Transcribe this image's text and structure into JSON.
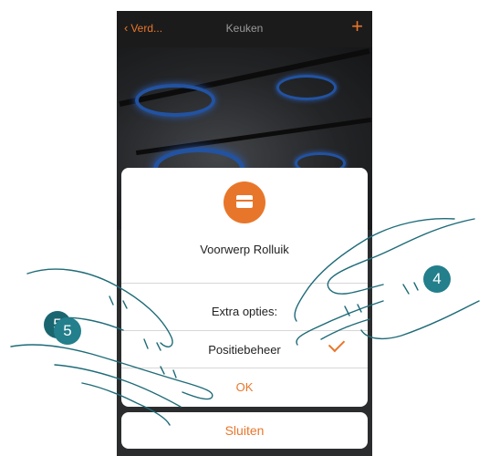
{
  "header": {
    "back_label": "Verd...",
    "title": "Keuken",
    "add_symbol": "+"
  },
  "dialog": {
    "object_label": "Voorwerp Rolluik",
    "extra_label": "Extra opties:",
    "option_label": "Positiebeheer",
    "option_selected": true,
    "ok_label": "OK"
  },
  "close_label": "Sluiten",
  "callouts": {
    "step_right": "4",
    "step_left_back": "5",
    "step_left": "5"
  },
  "colors": {
    "accent": "#e8762a",
    "callout": "#227f8b",
    "hand_stroke": "#1e6b78",
    "navbar": "#1b1b1b"
  },
  "icons": [
    "back-chevron-icon",
    "plus-icon",
    "roller-shutter-icon",
    "checkmark-icon"
  ]
}
